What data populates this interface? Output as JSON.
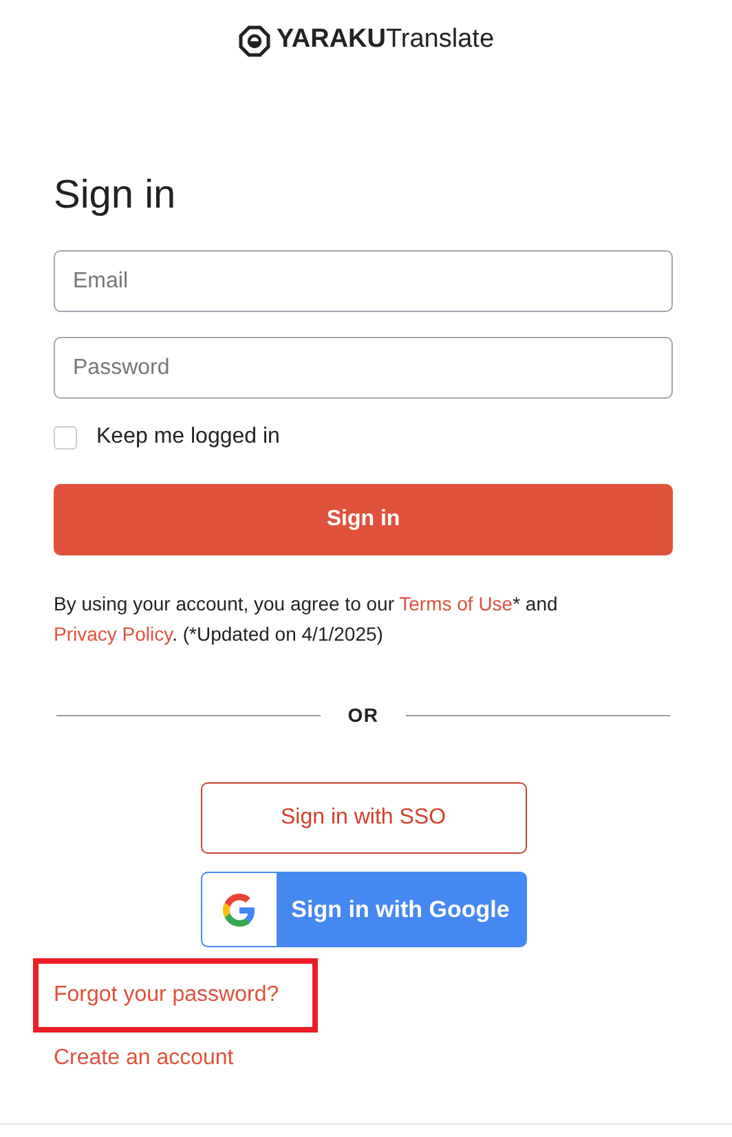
{
  "logo": {
    "brand": "YARAKU",
    "product": "Translate"
  },
  "title": "Sign in",
  "fields": [
    {
      "placeholder": "Email"
    },
    {
      "placeholder": "Password"
    }
  ],
  "remember": {
    "label": "Keep me logged in",
    "checked": false
  },
  "sign_in_button": "Sign in",
  "agreement": [
    {
      "kind": "text",
      "text": "By using your account, you agree to our "
    },
    {
      "kind": "link",
      "text": "Terms of Use"
    },
    {
      "kind": "text",
      "text": "* and "
    },
    {
      "kind": "link",
      "text": "Privacy Policy"
    },
    {
      "kind": "text",
      "text": ". (*Updated on 4/1/2025)"
    }
  ],
  "divider": "OR",
  "sso_button": "Sign in with SSO",
  "google_button": "Sign in with Google",
  "links": [
    {
      "text": "Forgot your password?",
      "highlighted": true
    },
    {
      "text": "Create an account",
      "highlighted": false
    }
  ]
}
